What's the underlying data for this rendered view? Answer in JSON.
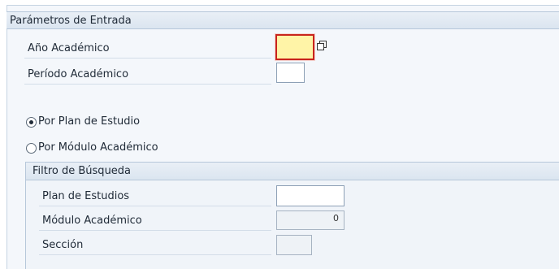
{
  "section": {
    "title": "Parámetros de Entrada",
    "fields": [
      {
        "label": "Año Académico",
        "value": ""
      },
      {
        "label": "Período Académico",
        "value": ""
      }
    ]
  },
  "search_mode": {
    "options": [
      {
        "label": "Por Plan de Estudio",
        "selected": true
      },
      {
        "label": "Por Módulo Académico",
        "selected": false
      }
    ]
  },
  "filter": {
    "title": "Filtro de Búsqueda",
    "fields": [
      {
        "label": "Plan de Estudios",
        "value": ""
      },
      {
        "label": "Módulo Académico",
        "value": "0"
      },
      {
        "label": "Sección",
        "value": ""
      }
    ]
  },
  "icons": {
    "value_help": "multiple-selection-icon"
  },
  "colors": {
    "focus_border": "#c8241c",
    "focus_fill": "#fff4a7",
    "header_bg": "#dbe5f0"
  }
}
